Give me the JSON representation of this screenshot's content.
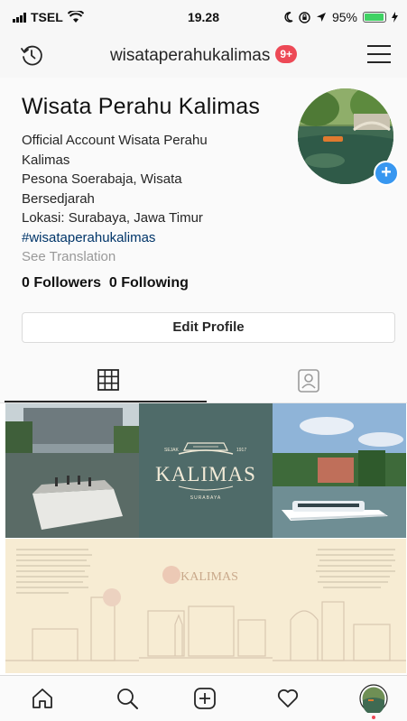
{
  "status_bar": {
    "carrier": "TSEL",
    "time": "19.28",
    "battery_percent": "95%",
    "battery_level": 0.95,
    "icons": [
      "signal-icon",
      "wifi-icon",
      "moon-icon",
      "lock-rotation-icon",
      "location-arrow-icon",
      "battery-icon",
      "charging-icon"
    ]
  },
  "top_nav": {
    "username": "wisataperahukalimas",
    "notification_badge": "9+",
    "icons": [
      "history-icon",
      "menu-icon"
    ]
  },
  "profile": {
    "full_name": "Wisata Perahu Kalimas",
    "bio_lines": [
      "Official Account Wisata Perahu",
      "Kalimas",
      "Pesona Soerabaja, Wisata",
      "Bersedjarah",
      "Lokasi: Surabaya, Jawa Timur"
    ],
    "hashtag": "#wisataperahukalimas",
    "see_translation": "See Translation",
    "stats": "0 Followers  0 Following",
    "edit_profile_label": "Edit Profile"
  },
  "tabs": {
    "active": "grid",
    "icons": [
      "grid-icon",
      "tagged-icon"
    ]
  },
  "posts": {
    "kalimas_logo_text": "KALIMAS",
    "kalimas_logo_small_left": "SEJAK",
    "kalimas_logo_small_right": "1917",
    "kalimas_logo_sub": "SURABAYA",
    "illustration_logo_text": "KALIMAS"
  },
  "bottom_nav": {
    "icons": [
      "home-icon",
      "search-icon",
      "add-post-icon",
      "activity-heart-icon",
      "profile-avatar-icon"
    ]
  },
  "colors": {
    "accent_blue": "#3897f0",
    "badge_red": "#ed4956",
    "hashtag_blue": "#003569",
    "teal_tile": "#4f6b69",
    "cream_tile": "#f7ecd3"
  }
}
